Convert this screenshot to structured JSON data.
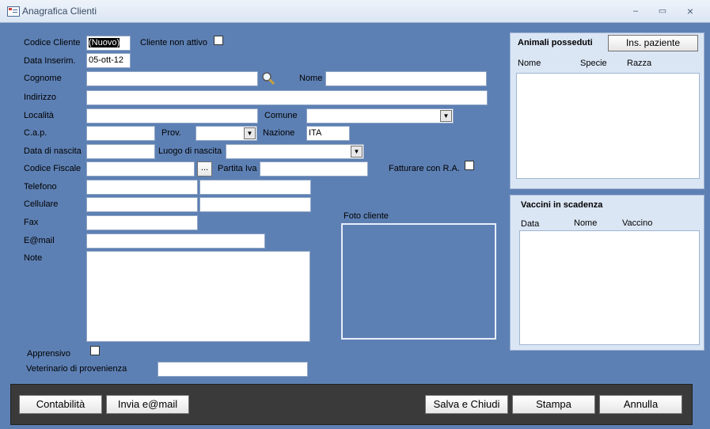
{
  "window": {
    "title": "Anagrafica Clienti",
    "min": "–",
    "max": "▭",
    "close": "×"
  },
  "form": {
    "codice_cliente": {
      "label": "Codice Cliente",
      "value": "(Nuovo)"
    },
    "cliente_non_attivo": {
      "label": "Cliente non attivo",
      "checked": false
    },
    "data_inserim": {
      "label": "Data Inserim.",
      "value": "05-ott-12"
    },
    "cognome": {
      "label": "Cognome",
      "value": ""
    },
    "nome": {
      "label": "Nome",
      "value": ""
    },
    "indirizzo": {
      "label": "Indirizzo",
      "value": ""
    },
    "localita": {
      "label": "Località",
      "value": ""
    },
    "comune": {
      "label": "Comune",
      "value": ""
    },
    "cap": {
      "label": "C.a.p.",
      "value": ""
    },
    "prov": {
      "label": "Prov.",
      "value": ""
    },
    "nazione": {
      "label": "Nazione",
      "value": "ITA"
    },
    "data_nascita": {
      "label": "Data di nascita",
      "value": ""
    },
    "luogo_nascita": {
      "label": "Luogo di nascita",
      "value": ""
    },
    "codice_fiscale": {
      "label": "Codice Fiscale",
      "value": "",
      "button": "..."
    },
    "partita_iva": {
      "label": "Partita Iva",
      "value": ""
    },
    "fatturare_ra": {
      "label": "Fatturare con R.A.",
      "checked": false
    },
    "telefono": {
      "label": "Telefono"
    },
    "cellulare": {
      "label": "Cellulare"
    },
    "fax": {
      "label": "Fax"
    },
    "email": {
      "label": "E@mail"
    },
    "note": {
      "label": "Note"
    },
    "foto": {
      "label": "Foto cliente"
    },
    "apprensivo": {
      "label": "Apprensivo",
      "checked": false
    },
    "veterinario": {
      "label": "Veterinario di provenienza",
      "value": ""
    }
  },
  "animali": {
    "title": "Animali posseduti",
    "button": "Ins. paziente",
    "columns": [
      "Nome",
      "Specie",
      "Razza"
    ]
  },
  "vaccini": {
    "title": "Vaccini in scadenza",
    "columns": [
      "Data",
      "Nome",
      "Vaccino"
    ]
  },
  "footer": {
    "contabilita": "Contabilità",
    "invia_email": "Invia e@mail",
    "salva_chiudi": "Salva e Chiudi",
    "stampa": "Stampa",
    "annulla": "Annulla"
  },
  "icons": {
    "search": "magnifier-icon",
    "combo": "chevron-down-icon"
  }
}
